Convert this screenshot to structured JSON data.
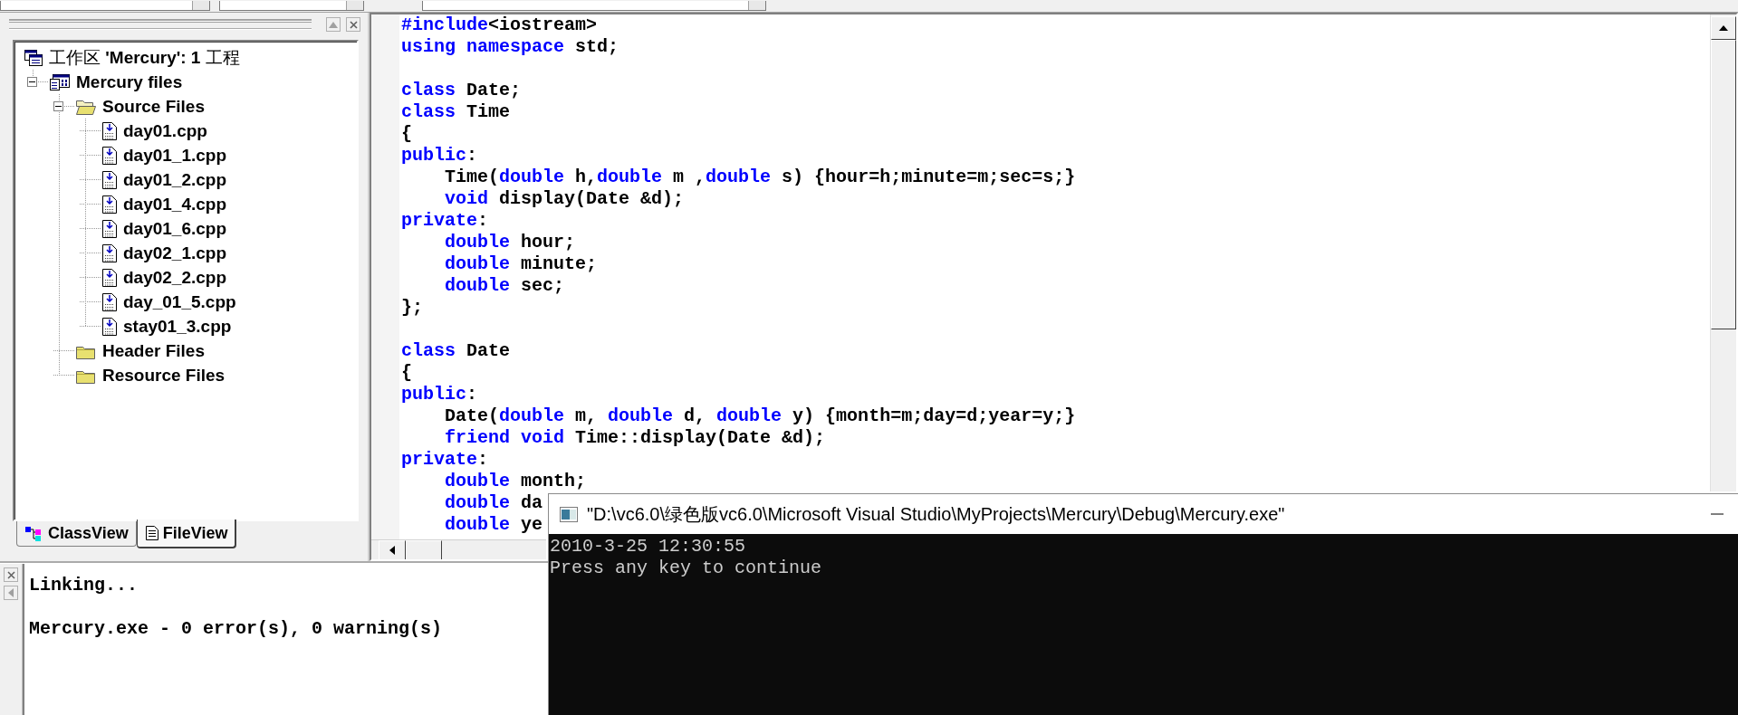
{
  "workspace": {
    "tree": {
      "label": "工作区 **'Mercury': 1** 工程",
      "kind": "workspace",
      "children": [
        {
          "label": "Mercury files",
          "kind": "project",
          "expanded": true,
          "children": [
            {
              "label": "Source Files",
              "kind": "folder",
              "expanded": true,
              "children": [
                {
                  "label": "day01.cpp",
                  "kind": "file"
                },
                {
                  "label": "day01_1.cpp",
                  "kind": "file"
                },
                {
                  "label": "day01_2.cpp",
                  "kind": "file"
                },
                {
                  "label": "day01_4.cpp",
                  "kind": "file"
                },
                {
                  "label": "day01_6.cpp",
                  "kind": "file"
                },
                {
                  "label": "day02_1.cpp",
                  "kind": "file"
                },
                {
                  "label": "day02_2.cpp",
                  "kind": "file"
                },
                {
                  "label": "day_01_5.cpp",
                  "kind": "file"
                },
                {
                  "label": "stay01_3.cpp",
                  "kind": "file"
                }
              ]
            },
            {
              "label": "Header Files",
              "kind": "folder"
            },
            {
              "label": "Resource Files",
              "kind": "folder"
            }
          ]
        }
      ]
    },
    "tabs": [
      {
        "label": "ClassView",
        "kind": "class",
        "selected": false
      },
      {
        "label": "FileView",
        "kind": "file",
        "selected": true
      }
    ]
  },
  "editor": {
    "lines": [
      {
        "kind": "code",
        "segments": [
          {
            "kind": "keyword",
            "text": "#include"
          },
          {
            "kind": "plain",
            "text": "<iostream>"
          }
        ]
      },
      {
        "kind": "code",
        "segments": [
          {
            "kind": "keyword",
            "text": "using namespace"
          },
          {
            "kind": "plain",
            "text": " std;"
          }
        ]
      },
      {
        "kind": "blank"
      },
      {
        "kind": "code",
        "segments": [
          {
            "kind": "keyword",
            "text": "class"
          },
          {
            "kind": "plain",
            "text": " Date;"
          }
        ]
      },
      {
        "kind": "code",
        "segments": [
          {
            "kind": "keyword",
            "text": "class"
          },
          {
            "kind": "plain",
            "text": " Time"
          }
        ]
      },
      {
        "kind": "code",
        "segments": [
          {
            "kind": "plain",
            "text": "{"
          }
        ]
      },
      {
        "kind": "code",
        "segments": [
          {
            "kind": "keyword",
            "text": "public"
          },
          {
            "kind": "plain",
            "text": ":"
          }
        ]
      },
      {
        "kind": "code",
        "segments": [
          {
            "kind": "plain",
            "text": "    Time("
          },
          {
            "kind": "keyword",
            "text": "double"
          },
          {
            "kind": "plain",
            "text": " h,"
          },
          {
            "kind": "keyword",
            "text": "double"
          },
          {
            "kind": "plain",
            "text": " m ,"
          },
          {
            "kind": "keyword",
            "text": "double"
          },
          {
            "kind": "plain",
            "text": " s) {hour=h;minute=m;sec=s;}"
          }
        ]
      },
      {
        "kind": "code",
        "segments": [
          {
            "kind": "keyword",
            "text": "    void"
          },
          {
            "kind": "plain",
            "text": " display(Date &d);"
          }
        ]
      },
      {
        "kind": "code",
        "segments": [
          {
            "kind": "keyword",
            "text": "private"
          },
          {
            "kind": "plain",
            "text": ":"
          }
        ]
      },
      {
        "kind": "code",
        "segments": [
          {
            "kind": "keyword",
            "text": "    double"
          },
          {
            "kind": "plain",
            "text": " hour;"
          }
        ]
      },
      {
        "kind": "code",
        "segments": [
          {
            "kind": "keyword",
            "text": "    double"
          },
          {
            "kind": "plain",
            "text": " minute;"
          }
        ]
      },
      {
        "kind": "code",
        "segments": [
          {
            "kind": "keyword",
            "text": "    double"
          },
          {
            "kind": "plain",
            "text": " sec;"
          }
        ]
      },
      {
        "kind": "code",
        "segments": [
          {
            "kind": "plain",
            "text": "};"
          }
        ]
      },
      {
        "kind": "blank"
      },
      {
        "kind": "code",
        "segments": [
          {
            "kind": "keyword",
            "text": "class"
          },
          {
            "kind": "plain",
            "text": " Date"
          }
        ]
      },
      {
        "kind": "code",
        "segments": [
          {
            "kind": "plain",
            "text": "{"
          }
        ]
      },
      {
        "kind": "code",
        "segments": [
          {
            "kind": "keyword",
            "text": "public"
          },
          {
            "kind": "plain",
            "text": ":"
          }
        ]
      },
      {
        "kind": "code",
        "segments": [
          {
            "kind": "plain",
            "text": "    Date("
          },
          {
            "kind": "keyword",
            "text": "double"
          },
          {
            "kind": "plain",
            "text": " m, "
          },
          {
            "kind": "keyword",
            "text": "double"
          },
          {
            "kind": "plain",
            "text": " d, "
          },
          {
            "kind": "keyword",
            "text": "double"
          },
          {
            "kind": "plain",
            "text": " y) {month=m;day=d;year=y;}"
          }
        ]
      },
      {
        "kind": "code",
        "segments": [
          {
            "kind": "keyword",
            "text": "    friend void"
          },
          {
            "kind": "plain",
            "text": " Time::display(Date &d);"
          }
        ]
      },
      {
        "kind": "code",
        "segments": [
          {
            "kind": "keyword",
            "text": "private"
          },
          {
            "kind": "plain",
            "text": ":"
          }
        ]
      },
      {
        "kind": "code",
        "segments": [
          {
            "kind": "keyword",
            "text": "    double"
          },
          {
            "kind": "plain",
            "text": " month;"
          }
        ]
      },
      {
        "kind": "code",
        "segments": [
          {
            "kind": "keyword",
            "text": "    double"
          },
          {
            "kind": "plain",
            "text": " da"
          }
        ]
      },
      {
        "kind": "code",
        "segments": [
          {
            "kind": "keyword",
            "text": "    double"
          },
          {
            "kind": "plain",
            "text": " ye"
          }
        ]
      }
    ]
  },
  "output": {
    "lines": [
      {
        "kind": "text",
        "text": "Linking..."
      },
      {
        "kind": "blank"
      },
      {
        "kind": "text",
        "text": "Mercury.exe - 0 error(s), 0 warning(s)"
      }
    ]
  },
  "console": {
    "title": "\"D:\\vc6.0\\绿色版vc6.0\\Microsoft Visual Studio\\MyProjects\\Mercury\\Debug\\Mercury.exe\"",
    "lines": [
      "2010-3-25 12:30:55",
      "Press any key to continue"
    ]
  }
}
